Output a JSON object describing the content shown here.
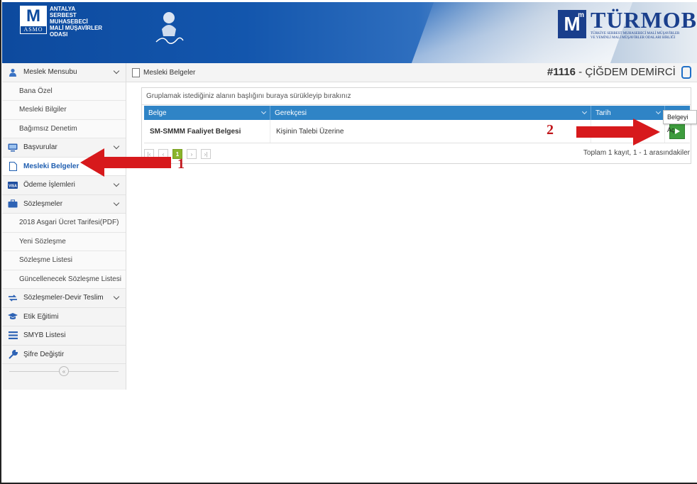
{
  "header": {
    "asmo_lines": [
      "ANTALYA",
      "SERBEST MUHASEBECİ",
      "MALİ MÜŞAVİRLER",
      "ODASI"
    ],
    "asmo_mark_letter": "M",
    "asmo_mark_sub": "m",
    "asmo_mark_name": "ASMO",
    "turmob_name": "TÜRMOB",
    "turmob_mark": "M",
    "turmob_mark_sub": "m",
    "turmob_sub1": "TÜRKİYE SERBEST MUHASEBECİ MALİ MÜŞAVİRLER",
    "turmob_sub2": "VE YEMİNLİ MALİ MÜŞAVİRLER ODALARI BİRLİĞİ"
  },
  "sidebar": {
    "items": [
      {
        "label": "Meslek Mensubu",
        "icon": "user-icon"
      },
      {
        "label": "Bana Özel"
      },
      {
        "label": "Mesleki Bilgiler"
      },
      {
        "label": "Bağımsız Denetim"
      },
      {
        "label": "Başvurular",
        "icon": "monitor-icon"
      },
      {
        "label": "Mesleki Belgeler",
        "icon": "document-icon"
      },
      {
        "label": "Ödeme İşlemleri",
        "icon": "visa-card-icon",
        "icon_text": "VISA"
      },
      {
        "label": "Sözleşmeler",
        "icon": "briefcase-icon"
      },
      {
        "label": "2018 Asgari Ücret Tarifesi(PDF)"
      },
      {
        "label": "Yeni Sözleşme"
      },
      {
        "label": "Sözleşme Listesi"
      },
      {
        "label": "Güncellenecek Sözleşme Listesi"
      },
      {
        "label": "Sözleşmeler-Devir Teslim",
        "icon": "transfer-icon"
      },
      {
        "label": "Etik Eğitimi",
        "icon": "graduation-cap-icon"
      },
      {
        "label": "SMYB Listesi",
        "icon": "list-icon"
      },
      {
        "label": "Şifre Değiştir",
        "icon": "wrench-icon"
      }
    ],
    "collapse_glyph": "«"
  },
  "breadcrumb": {
    "title": "Mesleki Belgeler",
    "user_id": "#1116",
    "user_sep": " - ",
    "user_name": "ÇİĞDEM DEMİRCİ"
  },
  "grid": {
    "group_hint": "Gruplamak istediğiniz alanın başlığını buraya sürükleyip bırakınız",
    "columns": [
      "Belge",
      "Gerekçesi",
      "Tarih"
    ],
    "rows": [
      {
        "belge": "SM-SMMM Faaliyet Belgesi",
        "gerekcesi": "Kişinin Talebi Üzerine",
        "tarih": ""
      }
    ],
    "tooltip": "Belgeyi Aç",
    "pager": {
      "first": "|‹",
      "prev": "‹",
      "current": "1",
      "next": "›",
      "last": "›|"
    },
    "pager_info": "Toplam 1 kayıt, 1 - 1 arasındakiler"
  },
  "annotations": {
    "arrow1_label": "1",
    "arrow2_label": "2",
    "arrow_color": "#d7191c"
  },
  "colors": {
    "header_blue": "#0d4a9e",
    "grid_header": "#2f84c6",
    "active_link": "#1f5eb0",
    "pager_current": "#8ab42a",
    "play_button": "#3d9c3d"
  }
}
